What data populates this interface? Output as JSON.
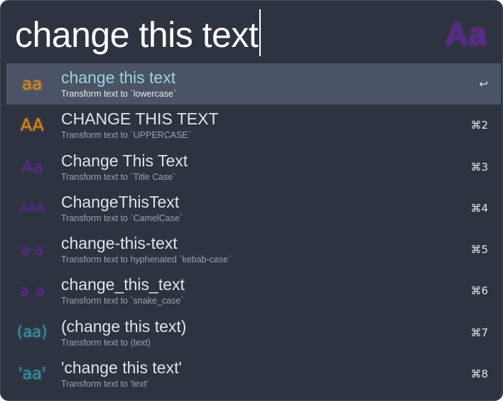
{
  "search": {
    "query": "change this text",
    "app_icon_glyph": "Aa",
    "app_icon_name": "case-transform-app-icon"
  },
  "colors": {
    "window_bg": "#2e3340",
    "selected_row_bg": "#4a5466",
    "orange": "#d98a1f",
    "purple": "#5a2a8a",
    "teal": "#3a93a8"
  },
  "results": [
    {
      "icon_glyph": "aa",
      "icon_color": "#d98a1f",
      "title": "change this text",
      "subtitle": "Transform text to `lowercase`",
      "shortcut": "↩",
      "selected": true
    },
    {
      "icon_glyph": "AA",
      "icon_color": "#d98a1f",
      "title": "CHANGE THIS TEXT",
      "subtitle": "Transform text to `UPPERCASE`",
      "shortcut": "⌘2",
      "selected": false
    },
    {
      "icon_glyph": "Aa",
      "icon_color": "#5a2a8a",
      "title": "Change This Text",
      "subtitle": "Transform text to `Title Case`",
      "shortcut": "⌘3",
      "selected": false
    },
    {
      "icon_glyph": "AaA",
      "icon_color": "#5a2a8a",
      "title": "ChangeThisText",
      "subtitle": "Transform text to `CamelCase`",
      "shortcut": "⌘4",
      "selected": false
    },
    {
      "icon_glyph": "a-a",
      "icon_color": "#5a2a8a",
      "title": "change-this-text",
      "subtitle": "Transform text to hyphenated `kebab-case`",
      "shortcut": "⌘5",
      "selected": false
    },
    {
      "icon_glyph": "a_a",
      "icon_color": "#5a2a8a",
      "title": "change_this_text",
      "subtitle": "Transform text to `snake_case`",
      "shortcut": "⌘6",
      "selected": false
    },
    {
      "icon_glyph": "(aa)",
      "icon_color": "#3a93a8",
      "title": "(change this text)",
      "subtitle": "Transform text to (text)",
      "shortcut": "⌘7",
      "selected": false
    },
    {
      "icon_glyph": "'aa'",
      "icon_color": "#3a93a8",
      "title": "'change this text'",
      "subtitle": "Transform text to 'text'",
      "shortcut": "⌘8",
      "selected": false
    }
  ]
}
